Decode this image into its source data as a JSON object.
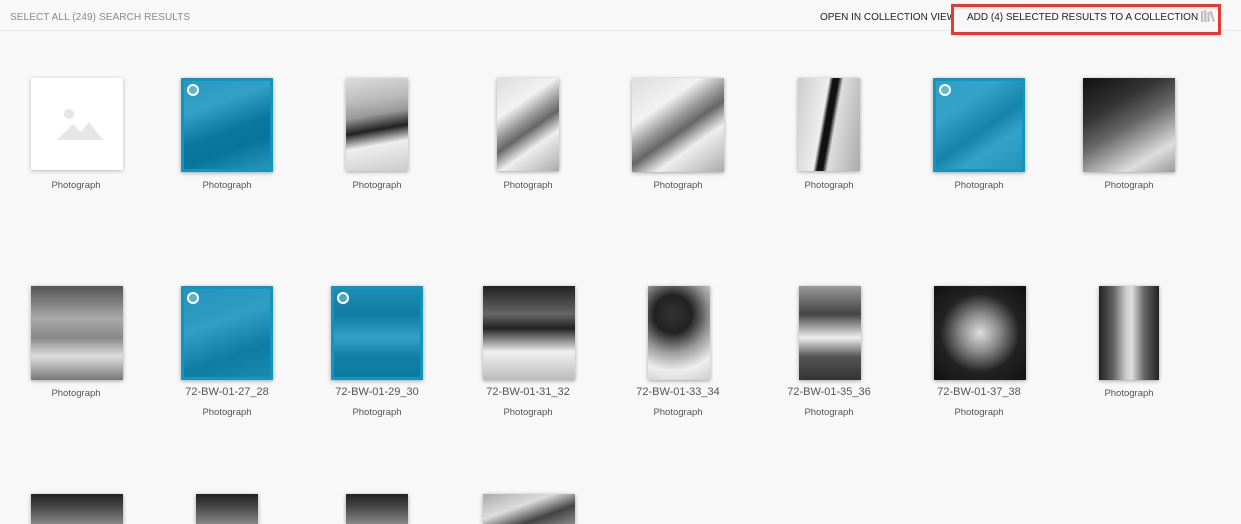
{
  "toolbar": {
    "select_all_label": "SELECT ALL (249) SEARCH RESULTS",
    "open_collection_label": "OPEN IN COLLECTION VIEW",
    "add_selected_label": "ADD (4) SELECTED RESULTS TO A COLLECTION",
    "add_selected_icon": "library-books-icon",
    "highlight_color": "#e53935"
  },
  "selection_color": "#1594bd",
  "rows": [
    {
      "items": [
        {
          "type": "Photograph",
          "title": "",
          "selected": false,
          "placeholder": true
        },
        {
          "type": "Photograph",
          "title": "",
          "selected": true
        },
        {
          "type": "Photograph",
          "title": "",
          "selected": false
        },
        {
          "type": "Photograph",
          "title": "",
          "selected": false
        },
        {
          "type": "Photograph",
          "title": "",
          "selected": false
        },
        {
          "type": "Photograph",
          "title": "",
          "selected": false
        },
        {
          "type": "Photograph",
          "title": "",
          "selected": true
        },
        {
          "type": "Photograph",
          "title": "",
          "selected": false
        }
      ]
    },
    {
      "items": [
        {
          "type": "Photograph",
          "title": "",
          "selected": false
        },
        {
          "type": "Photograph",
          "title": "72-BW-01-27_28",
          "selected": true
        },
        {
          "type": "Photograph",
          "title": "72-BW-01-29_30",
          "selected": true
        },
        {
          "type": "Photograph",
          "title": "72-BW-01-31_32",
          "selected": false
        },
        {
          "type": "Photograph",
          "title": "72-BW-01-33_34",
          "selected": false
        },
        {
          "type": "Photograph",
          "title": "72-BW-01-35_36",
          "selected": false
        },
        {
          "type": "Photograph",
          "title": "72-BW-01-37_38",
          "selected": false
        },
        {
          "type": "Photograph",
          "title": "",
          "selected": false
        }
      ]
    }
  ]
}
